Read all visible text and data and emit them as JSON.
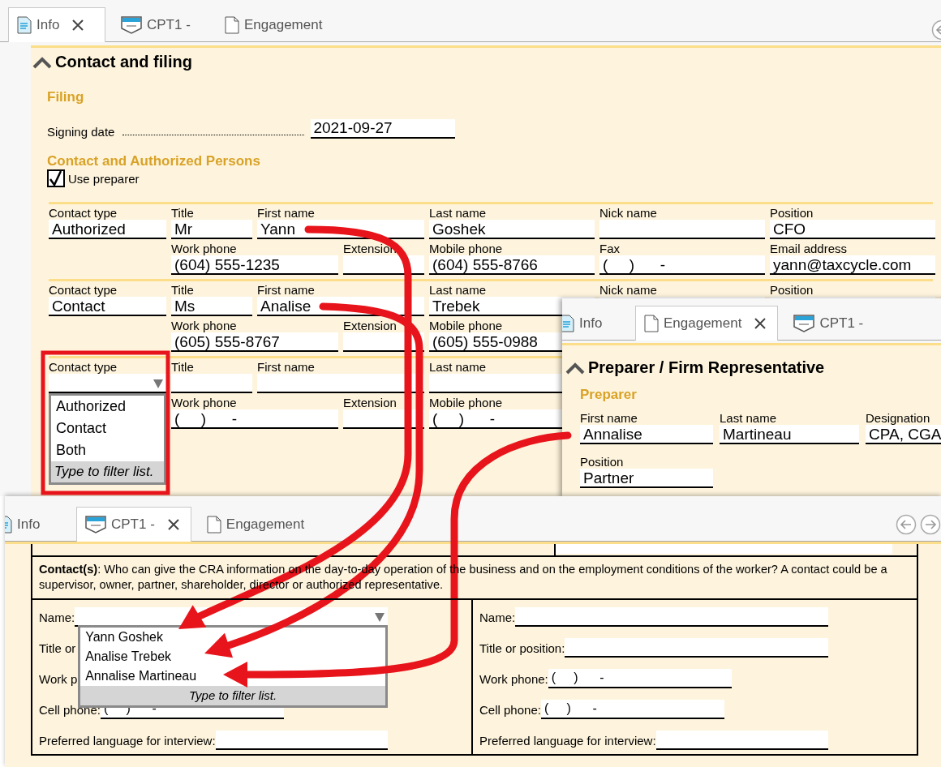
{
  "info_window": {
    "tabs": [
      {
        "label": "Info",
        "kind": "info",
        "selected": true
      },
      {
        "label": "CPT1 -",
        "kind": "form",
        "selected": false
      },
      {
        "label": "Engagement",
        "kind": "page",
        "selected": false
      }
    ],
    "section": {
      "title": "Contact and filing",
      "expanded": true
    },
    "filing": {
      "heading": "Filing",
      "signing_date_label": "Signing date",
      "signing_date": "2021-09-27"
    },
    "contacts_heading": "Contact and Authorized Persons",
    "use_preparer": {
      "label": "Use preparer",
      "checked": true
    },
    "contacts": [
      {
        "line1": [
          {
            "label": "Contact type",
            "kind": "text",
            "value": "Authorized"
          },
          {
            "label": "Title",
            "kind": "text",
            "value": "Mr"
          },
          {
            "label": "First name",
            "kind": "text",
            "value": "Yann"
          },
          {
            "label": "Last name",
            "kind": "text",
            "value": "Goshek"
          },
          {
            "label": "Nick name",
            "kind": "text"
          },
          {
            "label": "Position",
            "kind": "text",
            "value": "CFO"
          }
        ],
        "line2": [
          {
            "label": "Work phone",
            "kind": "text",
            "value": "(604) 555-1235"
          },
          {
            "label": "Extension",
            "kind": "text"
          },
          {
            "label": "Mobile phone",
            "kind": "text",
            "value": "(604) 555-8766"
          },
          {
            "label": "Fax",
            "kind": "phone",
            "placeholder": "(     )      -"
          },
          {
            "label": "Email address",
            "kind": "text",
            "value": "yann@taxcycle.com"
          }
        ]
      },
      {
        "line1": [
          {
            "label": "Contact type",
            "kind": "text",
            "value": "Contact"
          },
          {
            "label": "Title",
            "kind": "text",
            "value": "Ms"
          },
          {
            "label": "First name",
            "kind": "text",
            "value": "Analise"
          },
          {
            "label": "Last name",
            "kind": "text",
            "value": "Trebek"
          },
          {
            "label": "Nick name",
            "kind": "text"
          },
          {
            "label": "Position",
            "kind": "text"
          }
        ],
        "line2": [
          {
            "label": "Work phone",
            "kind": "text",
            "value": "(605) 555-8767"
          },
          {
            "label": "Extension",
            "kind": "text"
          },
          {
            "label": "Mobile phone",
            "kind": "text",
            "value": "(605) 555-0988"
          }
        ]
      },
      {
        "line1": [
          {
            "label": "Contact type",
            "kind": "dropdown",
            "options": [
              {
                "label": "Authorized",
                "selected": false
              },
              {
                "label": "Contact",
                "selected": false
              },
              {
                "label": "Both",
                "selected": false
              }
            ],
            "filter_hint": "Type to filter list."
          },
          {
            "label": "Title",
            "kind": "text"
          },
          {
            "label": "First name",
            "kind": "text"
          },
          {
            "label": "Last name",
            "kind": "text"
          }
        ],
        "line2": [
          {
            "label": "Work phone",
            "kind": "phone",
            "placeholder": "(     )      -"
          },
          {
            "label": "Extension",
            "kind": "text"
          },
          {
            "label": "Mobile phone",
            "kind": "phone",
            "placeholder": "(     )      -"
          }
        ]
      }
    ]
  },
  "engagement_window": {
    "tabs": [
      {
        "label": "Info",
        "kind": "info",
        "selected": false
      },
      {
        "label": "Engagement",
        "kind": "page",
        "selected": true
      },
      {
        "label": "CPT1 -",
        "kind": "form",
        "selected": false
      }
    ],
    "section": {
      "title": "Preparer / Firm Representative",
      "expanded": true
    },
    "heading": "Preparer",
    "fields": [
      {
        "label": "First name",
        "kind": "text",
        "value": "Annalise"
      },
      {
        "label": "Last name",
        "kind": "text",
        "value": "Martineau"
      },
      {
        "label": "Designation",
        "kind": "text",
        "value": "CPA, CGA"
      },
      {
        "label": "Position",
        "kind": "text",
        "value": "Partner"
      }
    ]
  },
  "cpt1_window": {
    "tabs": [
      {
        "label": "Info",
        "kind": "info",
        "selected": false
      },
      {
        "label": "CPT1 -",
        "kind": "form",
        "selected": true
      },
      {
        "label": "Engagement",
        "kind": "page",
        "selected": false
      }
    ],
    "intro": "**Contact(s)**: Who can give the CRA information on the day-to-day operation of the business and on the employment conditions of the worker? A contact could be a supervisor, owner, partner, shareholder, director or authorized representative.",
    "left_contact": [
      {
        "label": "Name:",
        "kind": "dropdown",
        "options": [
          {
            "label": "Yann Goshek",
            "selected": false
          },
          {
            "label": "Analise Trebek",
            "selected": false
          },
          {
            "label": "Annalise Martineau",
            "selected": false
          }
        ],
        "filter_hint": "Type to filter list."
      },
      {
        "label": "Title or",
        "kind": "label"
      },
      {
        "label": "Work p",
        "kind": "label"
      },
      {
        "label": "Cell phone:",
        "kind": "phone",
        "placeholder": "(     )      -"
      },
      {
        "label": "Preferred language for interview:",
        "kind": "text"
      }
    ],
    "right_contact": [
      {
        "label": "Name:",
        "kind": "text"
      },
      {
        "label": "Title or position:",
        "kind": "text"
      },
      {
        "label": "Work phone:",
        "kind": "phone",
        "placeholder": "(     )      -"
      },
      {
        "label": "Cell phone:",
        "kind": "phone",
        "placeholder": "(     )      -"
      },
      {
        "label": "Preferred language for interview:",
        "kind": "text"
      }
    ]
  }
}
